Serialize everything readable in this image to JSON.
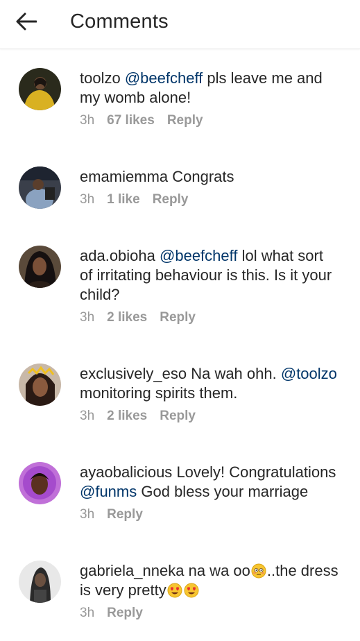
{
  "header": {
    "title": "Comments",
    "back_icon": "arrow-left-icon"
  },
  "comments": [
    {
      "username": "toolzo",
      "mention": "@beefcheff",
      "text_lines": [
        "pls leave me and",
        "my womb alone!"
      ],
      "time": "3h",
      "likes": "67 likes",
      "reply": "Reply"
    },
    {
      "username": "emamiemma",
      "text": "Congrats",
      "time": "3h",
      "likes": "1 like",
      "reply": "Reply"
    },
    {
      "username": "ada.obioha",
      "mention": "@beefcheff",
      "text_lines": [
        "lol what sort",
        "of irritating behaviour is this. Is it your",
        "child?"
      ],
      "time": "3h",
      "likes": "2 likes",
      "reply": "Reply"
    },
    {
      "username": "exclusively_eso",
      "text_before": "Na wah ohh.",
      "mention": "@toolzo",
      "text_after": "monitoring spirits them.",
      "time": "3h",
      "likes": "2 likes",
      "reply": "Reply"
    },
    {
      "username": "ayaobalicious",
      "text_before": "Lovely! Congratulations",
      "mention": "@funms",
      "text_after": "God bless your marriage",
      "time": "3h",
      "reply": "Reply"
    },
    {
      "username": "gabriela_nneka",
      "text_before": "na wa oo",
      "text_mid": "..the dress",
      "text_after": "is very pretty",
      "emoji_1": "flushed-face-emoji",
      "emoji_2": "heart-eyes-emoji",
      "time": "3h",
      "reply": "Reply"
    }
  ],
  "colors": {
    "text": "#262626",
    "meta": "#999999",
    "mention": "#003569",
    "divider": "#e6e6e6"
  }
}
